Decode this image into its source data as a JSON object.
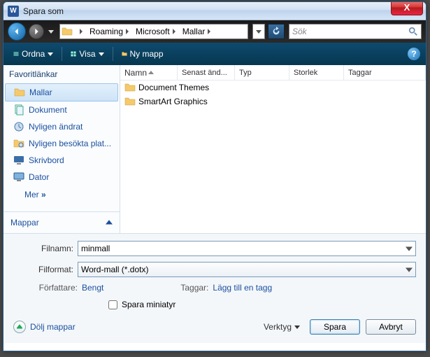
{
  "titlebar": {
    "app_initial": "W",
    "title": "Spara som",
    "close": "X"
  },
  "nav": {
    "breadcrumb": [
      "Roaming",
      "Microsoft",
      "Mallar"
    ],
    "search_placeholder": "Sök"
  },
  "toolbar": {
    "organize_label": "Ordna",
    "views_label": "Visa",
    "newfolder_label": "Ny mapp",
    "help": "?"
  },
  "sidebar": {
    "heading": "Favoritlänkar",
    "items": [
      {
        "label": "Mallar",
        "icon": "folder-icon"
      },
      {
        "label": "Dokument",
        "icon": "documents-icon"
      },
      {
        "label": "Nyligen ändrat",
        "icon": "recent-icon"
      },
      {
        "label": "Nyligen besökta plat...",
        "icon": "recent-places-icon"
      },
      {
        "label": "Skrivbord",
        "icon": "desktop-icon"
      },
      {
        "label": "Dator",
        "icon": "computer-icon"
      }
    ],
    "more": "Mer",
    "more_chev": "»",
    "folders": "Mappar"
  },
  "filelist": {
    "columns": [
      "Namn",
      "Senast änd...",
      "Typ",
      "Storlek",
      "Taggar"
    ],
    "rows": [
      {
        "name": "Document Themes"
      },
      {
        "name": "SmartArt Graphics"
      }
    ]
  },
  "form": {
    "filename_label": "Filnamn:",
    "filename_value": "minmall",
    "format_label": "Filformat:",
    "format_value": "Word-mall (*.dotx)",
    "author_label": "Författare:",
    "author_value": "Bengt",
    "tags_label": "Taggar:",
    "tags_value": "Lägg till en tagg",
    "thumb_label": "Spara miniatyr"
  },
  "footer": {
    "hide_folders": "Dölj mappar",
    "tools": "Verktyg",
    "save": "Spara",
    "cancel": "Avbryt"
  }
}
